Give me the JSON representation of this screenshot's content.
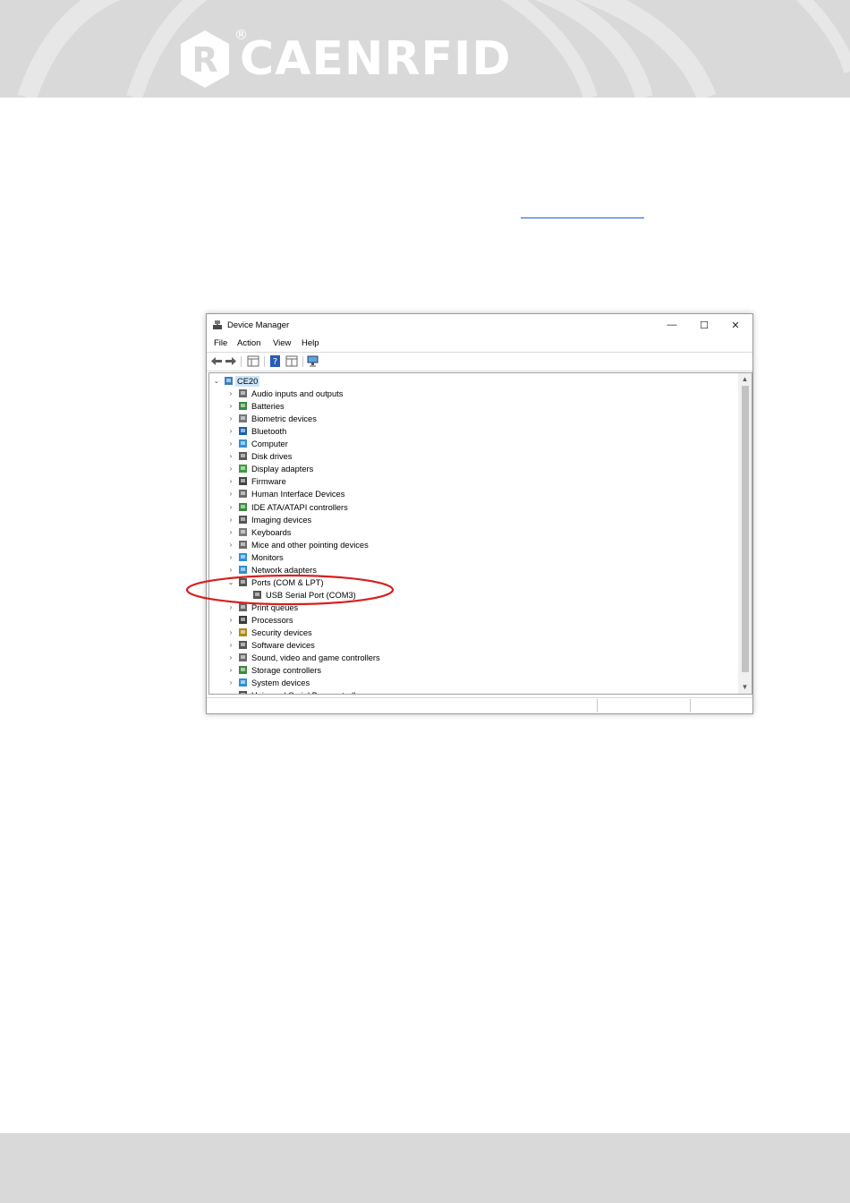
{
  "brand": {
    "name": "CAENRFID",
    "registered_mark": "®",
    "mark_letter": "R"
  },
  "window": {
    "title": "Device Manager",
    "controls": {
      "minimize": "—",
      "maximize": "☐",
      "close": "✕"
    },
    "menu": [
      "File",
      "Action",
      "View",
      "Help"
    ],
    "root": "CE20",
    "tree": [
      {
        "label": "Audio inputs and outputs",
        "icon": "speaker-icon",
        "color": "#6b6b6b"
      },
      {
        "label": "Batteries",
        "icon": "battery-icon",
        "color": "#3a8a3a"
      },
      {
        "label": "Biometric devices",
        "icon": "fingerprint-icon",
        "color": "#777777"
      },
      {
        "label": "Bluetooth",
        "icon": "bluetooth-icon",
        "color": "#1b5fad"
      },
      {
        "label": "Computer",
        "icon": "monitor-icon",
        "color": "#2f8fd6"
      },
      {
        "label": "Disk drives",
        "icon": "disk-drive-icon",
        "color": "#5a5a5a"
      },
      {
        "label": "Display adapters",
        "icon": "display-adapter-icon",
        "color": "#3b9b3b"
      },
      {
        "label": "Firmware",
        "icon": "chip-icon",
        "color": "#444444"
      },
      {
        "label": "Human Interface Devices",
        "icon": "hid-icon",
        "color": "#6b6b6b"
      },
      {
        "label": "IDE ATA/ATAPI controllers",
        "icon": "controller-icon",
        "color": "#3b8a3b"
      },
      {
        "label": "Imaging devices",
        "icon": "camera-icon",
        "color": "#555555"
      },
      {
        "label": "Keyboards",
        "icon": "keyboard-icon",
        "color": "#7a7a7a"
      },
      {
        "label": "Mice and other pointing devices",
        "icon": "mouse-icon",
        "color": "#6b6b6b"
      },
      {
        "label": "Monitors",
        "icon": "monitor-icon",
        "color": "#2f8fd6"
      },
      {
        "label": "Network adapters",
        "icon": "network-icon",
        "color": "#2f8fd6"
      },
      {
        "label": "Ports (COM & LPT)",
        "icon": "port-icon",
        "color": "#555555",
        "expanded": true,
        "children": [
          {
            "label": "USB Serial Port (COM3)",
            "icon": "port-icon",
            "color": "#555555"
          }
        ]
      },
      {
        "label": "Print queues",
        "icon": "printer-icon",
        "color": "#666666"
      },
      {
        "label": "Processors",
        "icon": "processor-icon",
        "color": "#3a3a3a"
      },
      {
        "label": "Security devices",
        "icon": "security-icon",
        "color": "#b08a1a"
      },
      {
        "label": "Software devices",
        "icon": "software-icon",
        "color": "#555555"
      },
      {
        "label": "Sound, video and game controllers",
        "icon": "speaker-icon",
        "color": "#6b6b6b"
      },
      {
        "label": "Storage controllers",
        "icon": "storage-icon",
        "color": "#3b8a3b"
      },
      {
        "label": "System devices",
        "icon": "system-icon",
        "color": "#2f8fd6"
      },
      {
        "label": "Universal Serial Bus controllers",
        "icon": "usb-icon",
        "color": "#555555"
      }
    ]
  },
  "colors": {
    "band_gray": "#d9d9d9",
    "highlight_ellipse": "#d62020",
    "link_blue": "#1a5ad8",
    "selection": "#cce4f7"
  }
}
